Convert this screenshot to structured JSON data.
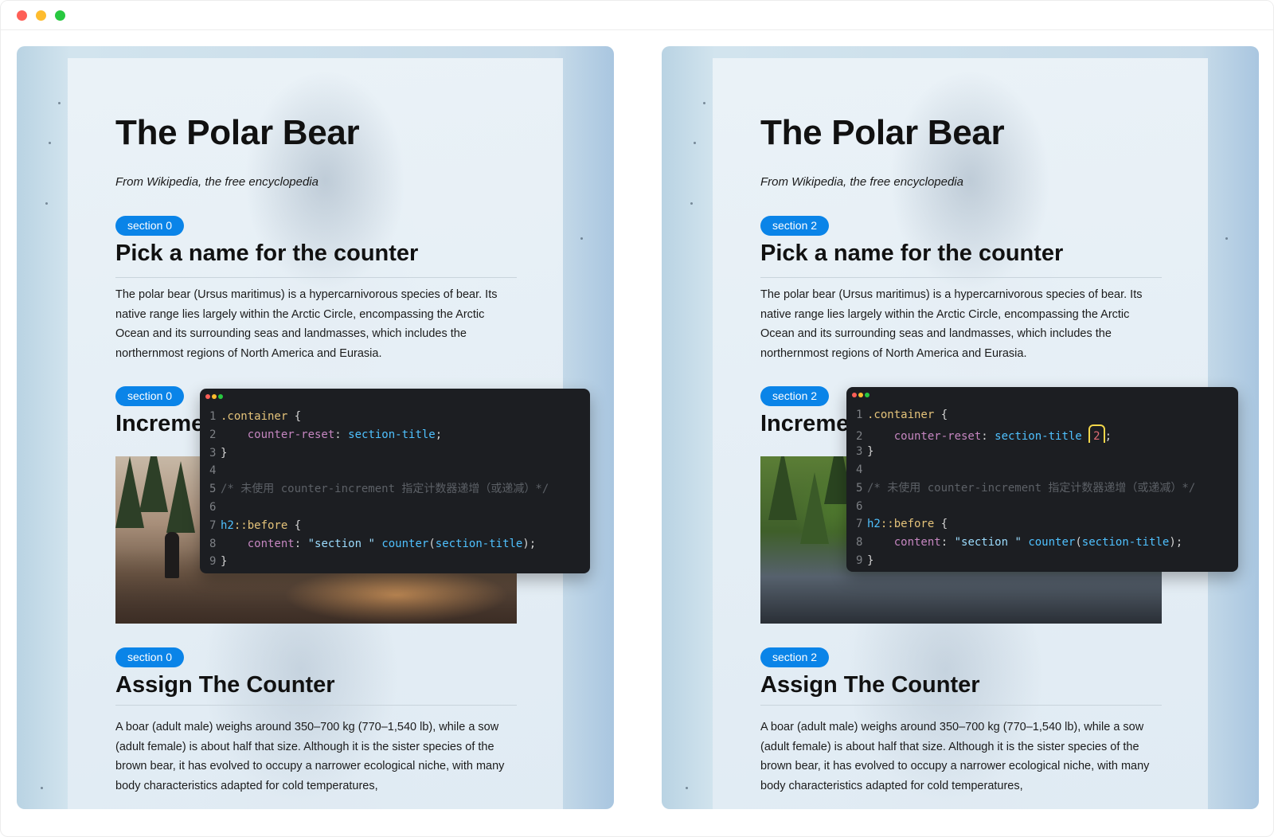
{
  "window": {
    "controls": [
      "close",
      "minimize",
      "maximize"
    ]
  },
  "panels": [
    {
      "title": "The Polar Bear",
      "subtitle": "From Wikipedia, the free encyclopedia",
      "section_badge": "section 0",
      "heading1": "Pick a name for the counter",
      "paragraph1": "The polar bear (Ursus maritimus) is a hypercarnivorous species of bear. Its native range lies largely within the Arctic Circle, encompassing the Arctic Ocean and its surrounding seas and landmasses, which includes the northernmost regions of North America and Eurasia.",
      "heading2_partial": "Increme",
      "heading3": "Assign The Counter",
      "paragraph3": "A boar (adult male) weighs around 350–700 kg (770–1,540 lb), while a sow (adult female) is about half that size. Although it is the sister species of the brown bear, it has evolved to occupy a narrower ecological niche, with many body characteristics adapted for cold temperatures,",
      "code": {
        "numbers": [
          "1",
          "2",
          "3",
          "4",
          "5",
          "6",
          "7",
          "8",
          "9"
        ],
        "l1_sel": ".container",
        "l1_brace": " {",
        "l2_prop": "counter-reset",
        "l2_colon": ": ",
        "l2_val": "section-title",
        "l2_end": ";",
        "l3": "}",
        "l5": "/* 未使用 counter-increment 指定计数器递增（或递减）*/",
        "l7_kw": "h2",
        "l7_sel": "::before",
        "l7_brace": " {",
        "l8_prop": "content",
        "l8_colon": ": ",
        "l8_str": "\"section \"",
        "l8_fn": "counter",
        "l8_arg": "section-title",
        "l8_end": ");",
        "l9": "}"
      }
    },
    {
      "title": "The Polar Bear",
      "subtitle": "From Wikipedia, the free encyclopedia",
      "section_badge": "section 2",
      "heading1": "Pick a name for the counter",
      "paragraph1": "The polar bear (Ursus maritimus) is a hypercarnivorous species of bear. Its native range lies largely within the Arctic Circle, encompassing the Arctic Ocean and its surrounding seas and landmasses, which includes the northernmost regions of North America and Eurasia.",
      "heading2_partial": "Increme",
      "heading3": "Assign The Counter",
      "paragraph3": "A boar (adult male) weighs around 350–700 kg (770–1,540 lb), while a sow (adult female) is about half that size. Although it is the sister species of the brown bear, it has evolved to occupy a narrower ecological niche, with many body characteristics adapted for cold temperatures,",
      "code": {
        "numbers": [
          "1",
          "2",
          "3",
          "4",
          "5",
          "6",
          "7",
          "8",
          "9"
        ],
        "l1_sel": ".container",
        "l1_brace": " {",
        "l2_prop": "counter-reset",
        "l2_colon": ": ",
        "l2_val": "section-title",
        "l2_highlight": "2",
        "l2_end": ";",
        "l3": "}",
        "l5": "/* 未使用 counter-increment 指定计数器递增（或递减）*/",
        "l7_kw": "h2",
        "l7_sel": "::before",
        "l7_brace": " {",
        "l8_prop": "content",
        "l8_colon": ": ",
        "l8_str": "\"section \"",
        "l8_fn": "counter",
        "l8_arg": "section-title",
        "l8_end": ");",
        "l9": "}"
      }
    }
  ],
  "colors": {
    "badge": "#0a84e8",
    "highlight_border": "#f2d64a"
  }
}
